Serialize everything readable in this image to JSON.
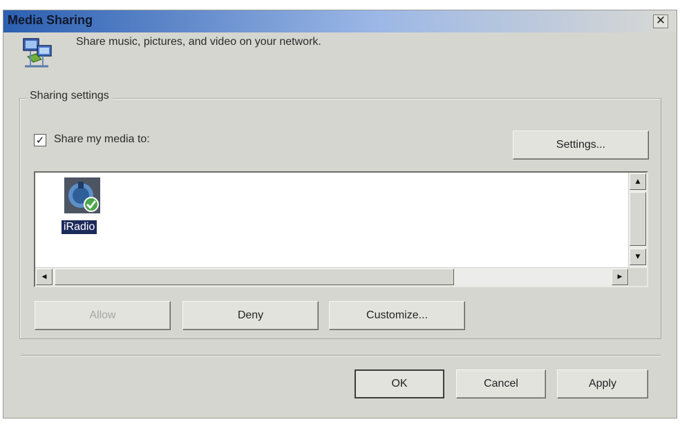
{
  "window": {
    "title": "Media Sharing",
    "close_glyph": "✕"
  },
  "header": {
    "icon": "network-media-icon",
    "text": "Share music, pictures, and video on your network."
  },
  "sharing_settings": {
    "group_label": "Sharing settings",
    "share_checkbox": {
      "checked": true,
      "glyph": "✓",
      "label": "Share my media to:"
    },
    "settings_button": "Settings...",
    "devices": [
      {
        "label": "iRadio",
        "icon": "radio-device-icon",
        "selected": true,
        "allowed": true
      }
    ],
    "allow_button": "Allow",
    "deny_button": "Deny",
    "customize_button": "Customize..."
  },
  "footer": {
    "ok_button": "OK",
    "cancel_button": "Cancel",
    "apply_button": "Apply"
  },
  "colors": {
    "title_gradient_start": "#2b5fb1",
    "selection": "#1d2a5c",
    "dialog_bg": "#d6d6d0"
  }
}
